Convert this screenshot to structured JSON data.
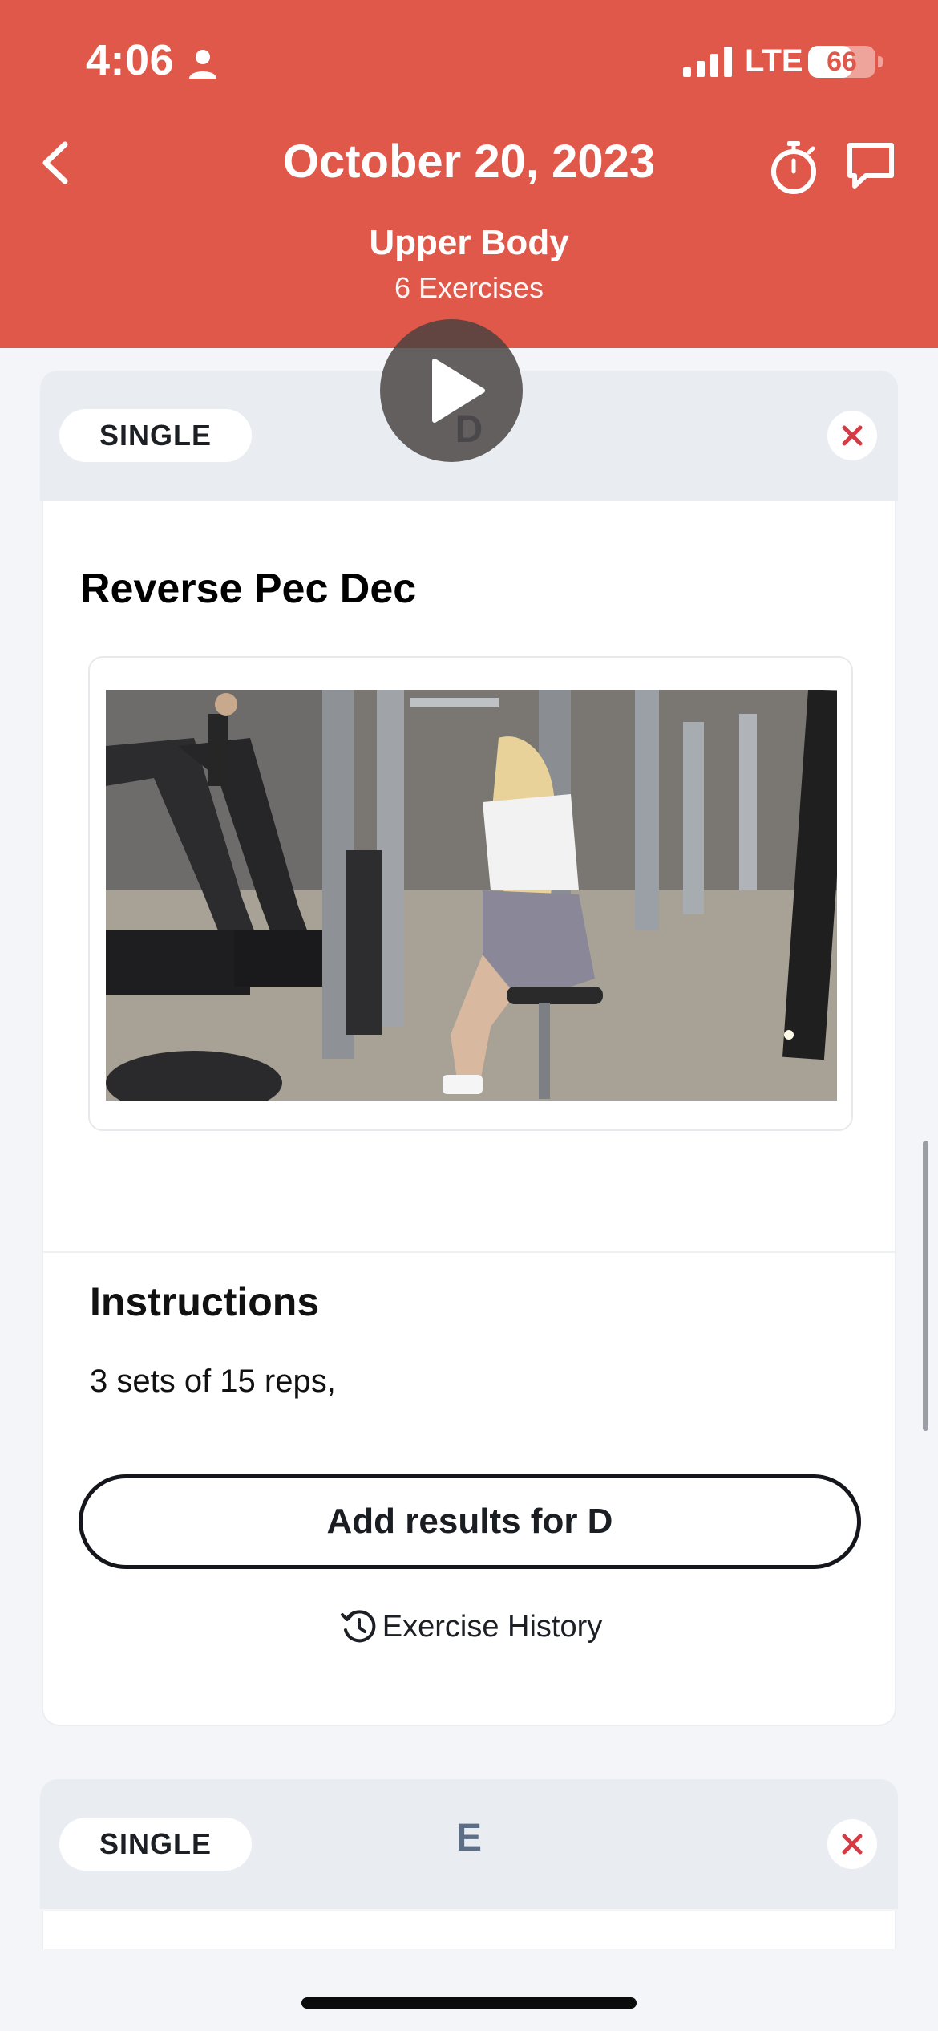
{
  "status_bar": {
    "time": "4:06",
    "network": "LTE",
    "battery_level": "66",
    "battery_fraction": 0.66
  },
  "header": {
    "title": "October 20, 2023",
    "workout_name": "Upper Body",
    "exercise_count": "6 Exercises",
    "background_color": "#e0584a"
  },
  "exercises": [
    {
      "type_label": "SINGLE",
      "letter": "D",
      "name": "Reverse Pec Dec",
      "instructions_title": "Instructions",
      "instructions_text": "3 sets of 15 reps,",
      "add_results_label": "Add results for D",
      "history_label": "Exercise History"
    },
    {
      "type_label": "SINGLE",
      "letter": "E"
    }
  ],
  "icons": {
    "back": "chevron-left-icon",
    "timer": "stopwatch-icon",
    "chat": "chat-bubble-icon",
    "close": "close-icon",
    "play": "play-icon",
    "history": "history-icon"
  },
  "colors": {
    "accent": "#e0584a",
    "close_x": "#d63a45",
    "letter": "#5e6f85"
  }
}
